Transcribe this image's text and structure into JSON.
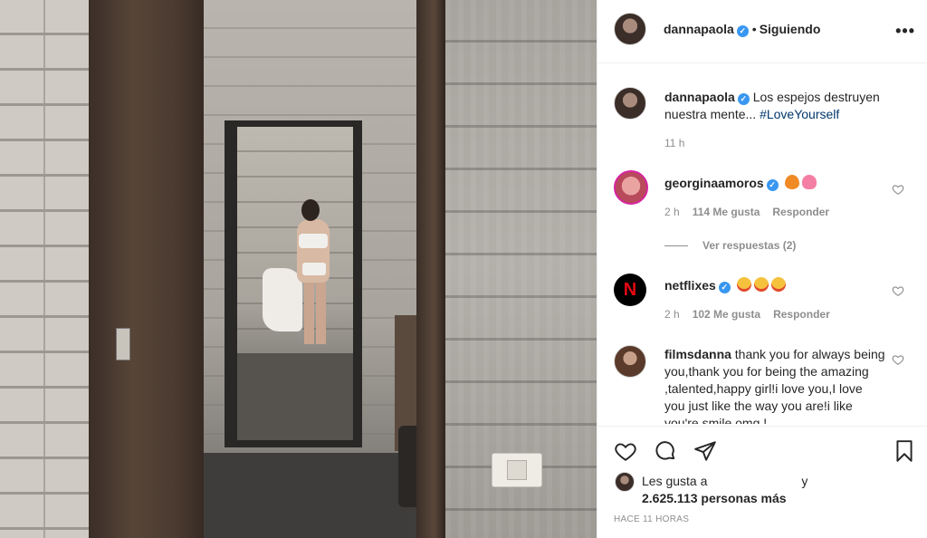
{
  "post": {
    "username": "dannapaola",
    "verified_mark": "✓",
    "dot": "•",
    "follow_status": "Siguiendo",
    "more_label": "•••",
    "caption_text": "Los espejos destruyen nuestra mente... ",
    "caption_hashtag": "#LoveYourself",
    "caption_time": "11 h"
  },
  "comments": [
    {
      "username": "georginaamoros",
      "emojis": [
        "orange-heart",
        "tulip"
      ],
      "time": "2 h",
      "likes": "114 Me gusta",
      "reply": "Responder",
      "view_replies": "Ver respuestas (2)"
    },
    {
      "username": "netflixes",
      "emojis": [
        "star-struck",
        "star-struck",
        "star-struck"
      ],
      "time": "2 h",
      "likes": "102 Me gusta",
      "reply": "Responder"
    },
    {
      "username": "filmsdanna",
      "text": "thank you for always being you,thank you for being the amazing ,talented,happy girl!i love you,I love you just like the way you are!i like you're smile omg !"
    }
  ],
  "footer": {
    "likes_prefix": "Les gusta a",
    "likes_conjunction": "y",
    "likes_count": "2.625.113 personas más",
    "time_ago": "HACE 11 HORAS"
  },
  "colors": {
    "text": "#262626",
    "muted": "#8e8e8e",
    "verified": "#3897f0",
    "hashtag": "#00376b",
    "netflix_red": "#e50914"
  }
}
